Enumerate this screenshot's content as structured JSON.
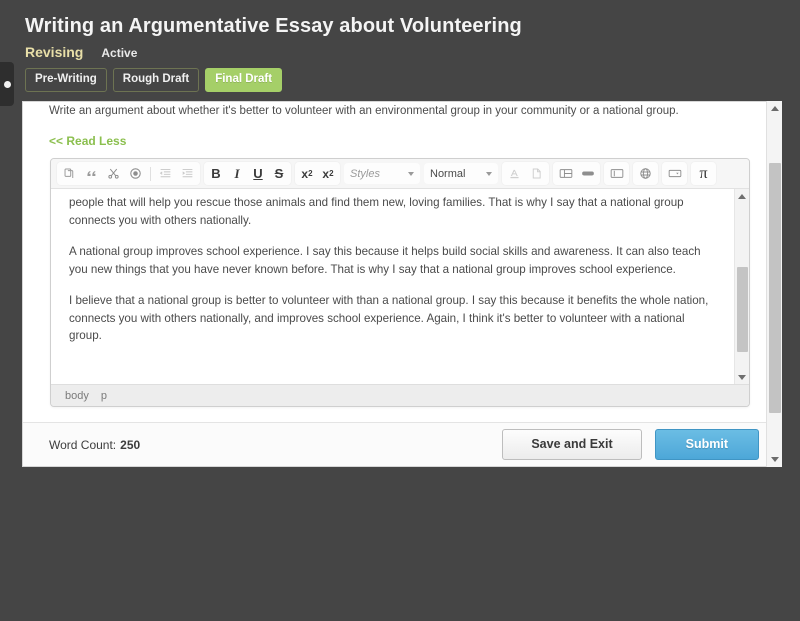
{
  "colors": {
    "page_background": "#454545",
    "accent_green": "#a5cf68",
    "stage_label": "#e8dfa8",
    "link_green": "#8bbf4e",
    "submit_blue": "#4da7d8"
  },
  "header": {
    "title": "Writing an Argumentative Essay about Volunteering",
    "stage": "Revising",
    "state": "Active",
    "tabs": [
      {
        "label": "Pre-Writing",
        "active": false
      },
      {
        "label": "Rough Draft",
        "active": false
      },
      {
        "label": "Final Draft",
        "active": true
      }
    ]
  },
  "assignment": {
    "prompt": "Write an argument about whether it's better to volunteer with an environmental group in your community or a national group.",
    "read_toggle": "<< Read Less"
  },
  "editor": {
    "toolbar": {
      "group1": [
        {
          "icon": "copy-icon",
          "label": "Copy"
        },
        {
          "icon": "quote-icon",
          "label": "Quote"
        },
        {
          "icon": "scissors-cut-icon",
          "label": "Cut"
        },
        {
          "icon": "record-target-icon",
          "label": "Paste"
        }
      ],
      "group2": [
        {
          "icon": "decrease-indent-icon",
          "label": "Decrease Indent"
        },
        {
          "icon": "increase-indent-icon",
          "label": "Increase Indent"
        }
      ],
      "group3": [
        {
          "icon": "bold-icon",
          "label": "B"
        },
        {
          "icon": "italic-icon",
          "label": "I"
        },
        {
          "icon": "underline-icon",
          "label": "U"
        },
        {
          "icon": "strikethrough-icon",
          "label": "S"
        }
      ],
      "group4": [
        {
          "icon": "subscript-icon",
          "label": "x",
          "affix": "2"
        },
        {
          "icon": "superscript-icon",
          "label": "x",
          "affix": "2"
        }
      ],
      "styles_select": {
        "value": "Styles",
        "caret": "chevron-down-icon"
      },
      "format_select": {
        "value": "Normal",
        "caret": "chevron-down-icon"
      },
      "group5": [
        {
          "icon": "text-color-icon",
          "label": "Text Color"
        },
        {
          "icon": "background-color-icon",
          "label": "Background Color"
        }
      ],
      "group6": [
        {
          "icon": "table-icon",
          "label": "Table"
        },
        {
          "icon": "horizontal-rule-icon",
          "label": "Horizontal Rule"
        }
      ],
      "group7": [
        {
          "icon": "page-break-icon",
          "label": "Page Break"
        }
      ],
      "group8": [
        {
          "icon": "globe-link-icon",
          "label": "Link"
        }
      ],
      "group9": [
        {
          "icon": "select-field-icon",
          "label": "Select Field"
        }
      ],
      "group10": [
        {
          "icon": "math-pi-icon",
          "label": "π"
        }
      ]
    },
    "paragraphs": [
      "people that will help you rescue those animals and find them new, loving families. That is why I say that a national group connects you with others nationally.",
      "A national group improves school experience. I say this because it helps build social skills and awareness. It can also teach you new things that you have never known before. That is why I say that a national group improves school experience.",
      "I believe that a national group is better to volunteer with than a national group. I say this because it benefits the whole nation, connects you with others nationally, and improves school experience. Again, I think it's better to volunteer with a national group."
    ],
    "status_path": [
      "body",
      "p"
    ]
  },
  "footer": {
    "word_count_label": "Word Count:",
    "word_count_value": "250",
    "save_label": "Save and Exit",
    "submit_label": "Submit"
  }
}
